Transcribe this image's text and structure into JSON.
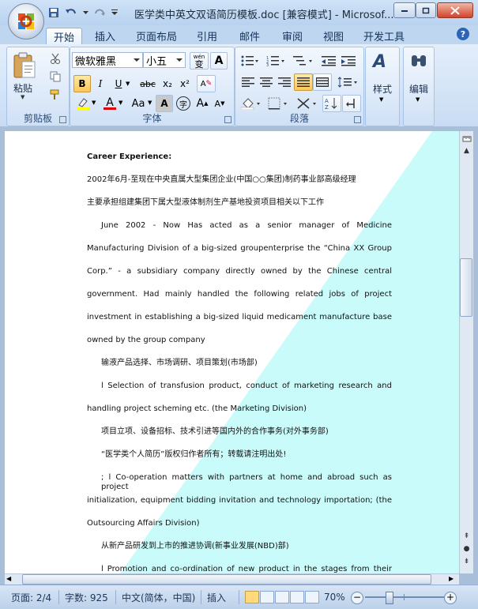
{
  "window": {
    "title": "医学类中英文双语简历模板.doc [兼容模式] - Microsof...",
    "controls": [
      "minimize-icon",
      "maximize-icon",
      "close-icon"
    ]
  },
  "quick_access": [
    "save-icon",
    "undo-icon",
    "redo-icon",
    "customize-icon"
  ],
  "tabs": [
    {
      "label": "开始",
      "active": true
    },
    {
      "label": "插入"
    },
    {
      "label": "页面布局"
    },
    {
      "label": "引用"
    },
    {
      "label": "邮件"
    },
    {
      "label": "审阅"
    },
    {
      "label": "视图"
    },
    {
      "label": "开发工具"
    }
  ],
  "ribbon": {
    "clipboard": {
      "paste_label": "粘贴",
      "group_label": "剪贴板"
    },
    "font": {
      "font_name": "微软雅黑",
      "font_size": "小五",
      "wen_label": "wén",
      "wen_char": "变",
      "a_box": "A",
      "bold": "B",
      "italic": "I",
      "underline": "U",
      "strike": "abc",
      "subscript": "x₂",
      "superscript": "x²",
      "clear_format": "A",
      "aa_label": "Aa",
      "char_shading": "A",
      "circle_char": "字",
      "grow": "A",
      "shrink": "A",
      "group_label": "字体"
    },
    "paragraph": {
      "group_label": "段落"
    },
    "styles": {
      "label": "样式"
    },
    "editing": {
      "label": "编辑"
    },
    "accent_colors": {
      "highlight": "#ffff00",
      "font_color": "#e00000",
      "cyan_band": "#c9fbfb"
    }
  },
  "document": {
    "lines": [
      {
        "text": "Career Experience:",
        "bold": true
      },
      {
        "text": "2002年6月-至现在中央直属大型集团企业(中国○○集团)制药事业部高级经理"
      },
      {
        "text": "主要承担组建集团下属大型液体制剂生产基地投资项目相关以下工作"
      },
      {
        "text": "June 2002 - Now Has acted as a senior manager of Medicine",
        "justify": true,
        "indent": true
      },
      {
        "text": "Manufacturing Division of a big-sized groupenterprise the “China XX Group",
        "justify": true
      },
      {
        "text": "Corp.” - a subsidiary company directly owned by the Chinese central",
        "justify": true
      },
      {
        "text": "government. Had mainly handled the following related jobs of project",
        "justify": true
      },
      {
        "text": "investment in establishing a big-sized liquid medicament manufacture base",
        "justify": true
      },
      {
        "text": "owned by the group company"
      },
      {
        "text": "输液产品选择、市场调研、项目策划(市场部)"
      },
      {
        "text": "l Selection of transfusion product, conduct of marketing research and",
        "justify": true,
        "indent": true
      },
      {
        "text": "handling project scheming etc. (the Marketing Division)"
      },
      {
        "text": "项目立项、设备招标、技术引进等国内外的合作事务(对外事务部)"
      },
      {
        "text": "“医学类个人简历”版权归作者所有；转载请注明出处!"
      },
      {
        "text": "; l Co-operation matters with partners at home and abroad such as project",
        "justify": true,
        "indent": true
      },
      {
        "text": "initialization, equipment bidding invitation and technology importation; (the",
        "justify": true
      },
      {
        "text": "Outsourcing Affairs Division)"
      },
      {
        "text": "从新产品研发到上市的推进协调(新事业发展(NBD)部)"
      },
      {
        "text": "l Promotion and co-ordination of new product in the stages from their",
        "justify": true,
        "indent": true
      }
    ]
  },
  "status": {
    "page": "页面: 2/4",
    "words": "字数: 925",
    "language": "中文(简体，中国)",
    "insert": "插入",
    "zoom": "70%",
    "zoom_out": "−",
    "zoom_in": "+"
  }
}
